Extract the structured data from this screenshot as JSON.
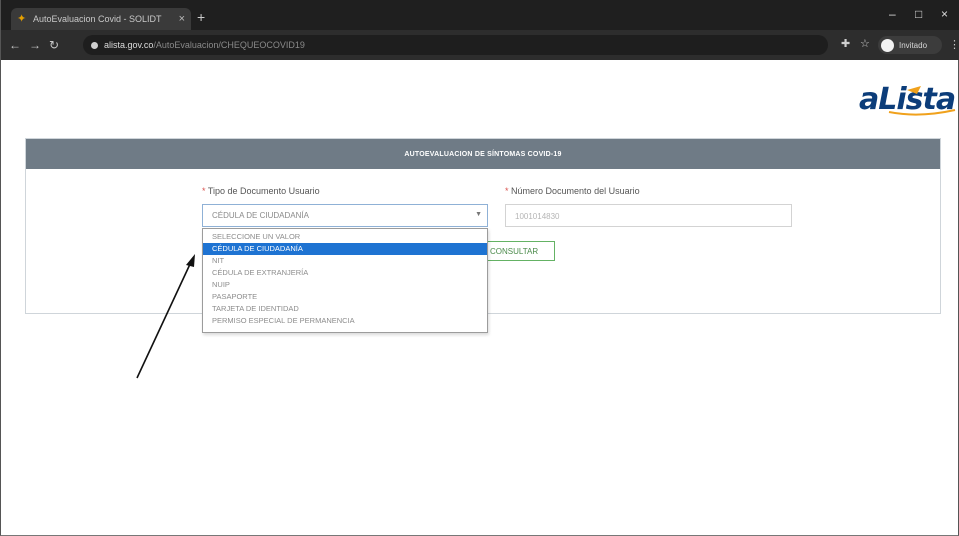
{
  "browser": {
    "tab_title": "AutoEvaluacion Covid - SOLIDT",
    "tab_close": "×",
    "new_tab": "+",
    "url_host": "alista.gov.co",
    "url_path": "/AutoEvaluacion/CHEQUEOCOVID19",
    "profile_name": "Invitado",
    "window_controls": [
      "–",
      "□",
      "×"
    ]
  },
  "logo": {
    "text": "aLista",
    "brand_color": "#0c3d7a"
  },
  "form": {
    "title": "AUTOEVALUACION DE SÍNTOMAS COVID-19",
    "doc_type_label": "Tipo de Documento Usuario",
    "doc_number_label": "Número Documento del Usuario",
    "required_mark": "*",
    "selected_doc_type": "CÉDULA DE CIUDADANÍA",
    "doc_number_value": "1001014830",
    "consult_button": "CONSULTAR"
  },
  "dropdown": {
    "options": [
      "SELECCIONE UN VALOR",
      "CÉDULA DE CIUDADANÍA",
      "NIT",
      "CÉDULA DE EXTRANJERÍA",
      "NUIP",
      "PASAPORTE",
      "TARJETA DE IDENTIDAD",
      "PERMISO ESPECIAL DE PERMANENCIA"
    ],
    "selected_index": 1,
    "highlight_color": "#1e73d2"
  },
  "colors": {
    "header_bar": "#6f7b86",
    "required": "#d9534f",
    "button_border": "#64b264"
  }
}
